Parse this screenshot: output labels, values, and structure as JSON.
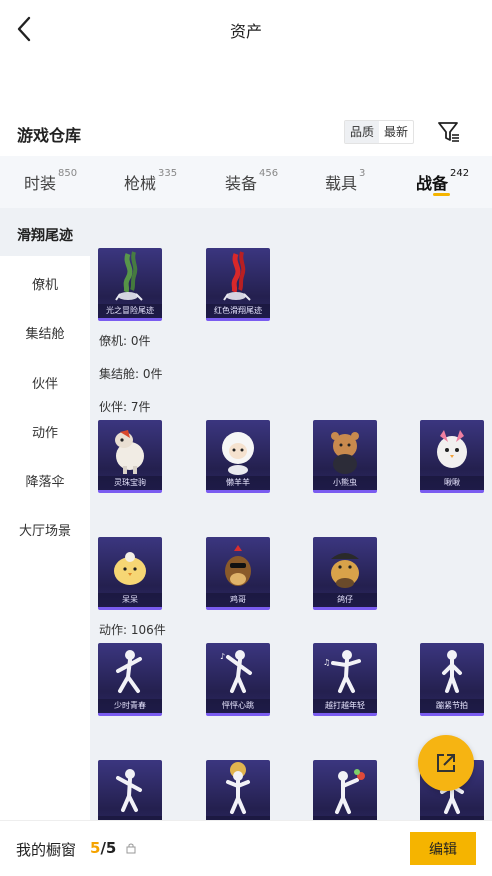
{
  "header": {
    "title": "资产"
  },
  "warehouse": {
    "title": "游戏仓库",
    "sort_options": [
      "品质",
      "最新"
    ],
    "active_sort": 0
  },
  "tabs": [
    {
      "label": "时装",
      "count": "850"
    },
    {
      "label": "枪械",
      "count": "335"
    },
    {
      "label": "装备",
      "count": "456"
    },
    {
      "label": "载具",
      "count": "3"
    },
    {
      "label": "战备",
      "count": "242",
      "active": true
    }
  ],
  "sidebar": {
    "header": "滑翔尾迹",
    "items": [
      "僚机",
      "集结舱",
      "伙伴",
      "动作",
      "降落伞",
      "大厅场景"
    ]
  },
  "sections": {
    "trails": [
      {
        "name": "光之冒险尾迹",
        "icon": "green-smoke-trail-icon"
      },
      {
        "name": "红色滑翔尾迹",
        "icon": "red-smoke-trail-icon"
      }
    ],
    "wingman_label": "僚机: 0件",
    "pod_label": "集结舱: 0件",
    "partner_label": "伙伴: 7件",
    "partners": [
      {
        "name": "灵珠宝驹",
        "icon": "pony-partner-icon"
      },
      {
        "name": "懒羊羊",
        "icon": "sheep-partner-icon"
      },
      {
        "name": "小熊虫",
        "icon": "bear-partner-icon"
      },
      {
        "name": "啾啾",
        "icon": "bird-partner-icon"
      },
      {
        "name": "呆呆",
        "icon": "chick-partner-icon"
      },
      {
        "name": "鸡哥",
        "icon": "rooster-partner-icon"
      },
      {
        "name": "鸽仔",
        "icon": "pigeon-partner-icon"
      }
    ],
    "emote_label": "动作: 106件",
    "emotes": [
      {
        "name": "少时青春",
        "icon": "dance-emote-icon"
      },
      {
        "name": "怦怦心跳",
        "icon": "dance-emote-icon"
      },
      {
        "name": "越打越年轻",
        "icon": "dance-emote-icon"
      },
      {
        "name": "蹦紧节拍",
        "icon": "dance-emote-icon"
      },
      {
        "name": "",
        "icon": "dance-emote-icon"
      },
      {
        "name": "",
        "icon": "dance-emote-icon"
      },
      {
        "name": "",
        "icon": "dance-emote-icon"
      },
      {
        "name": "",
        "icon": "dance-emote-icon"
      }
    ]
  },
  "bottom": {
    "showcase_label": "我的橱窗",
    "showcase_current": "5",
    "showcase_total": "/5",
    "edit_label": "编辑"
  },
  "colors": {
    "accent": "#f5b400",
    "card_bg": "#2d2966",
    "content_bg": "#eef1f5"
  }
}
